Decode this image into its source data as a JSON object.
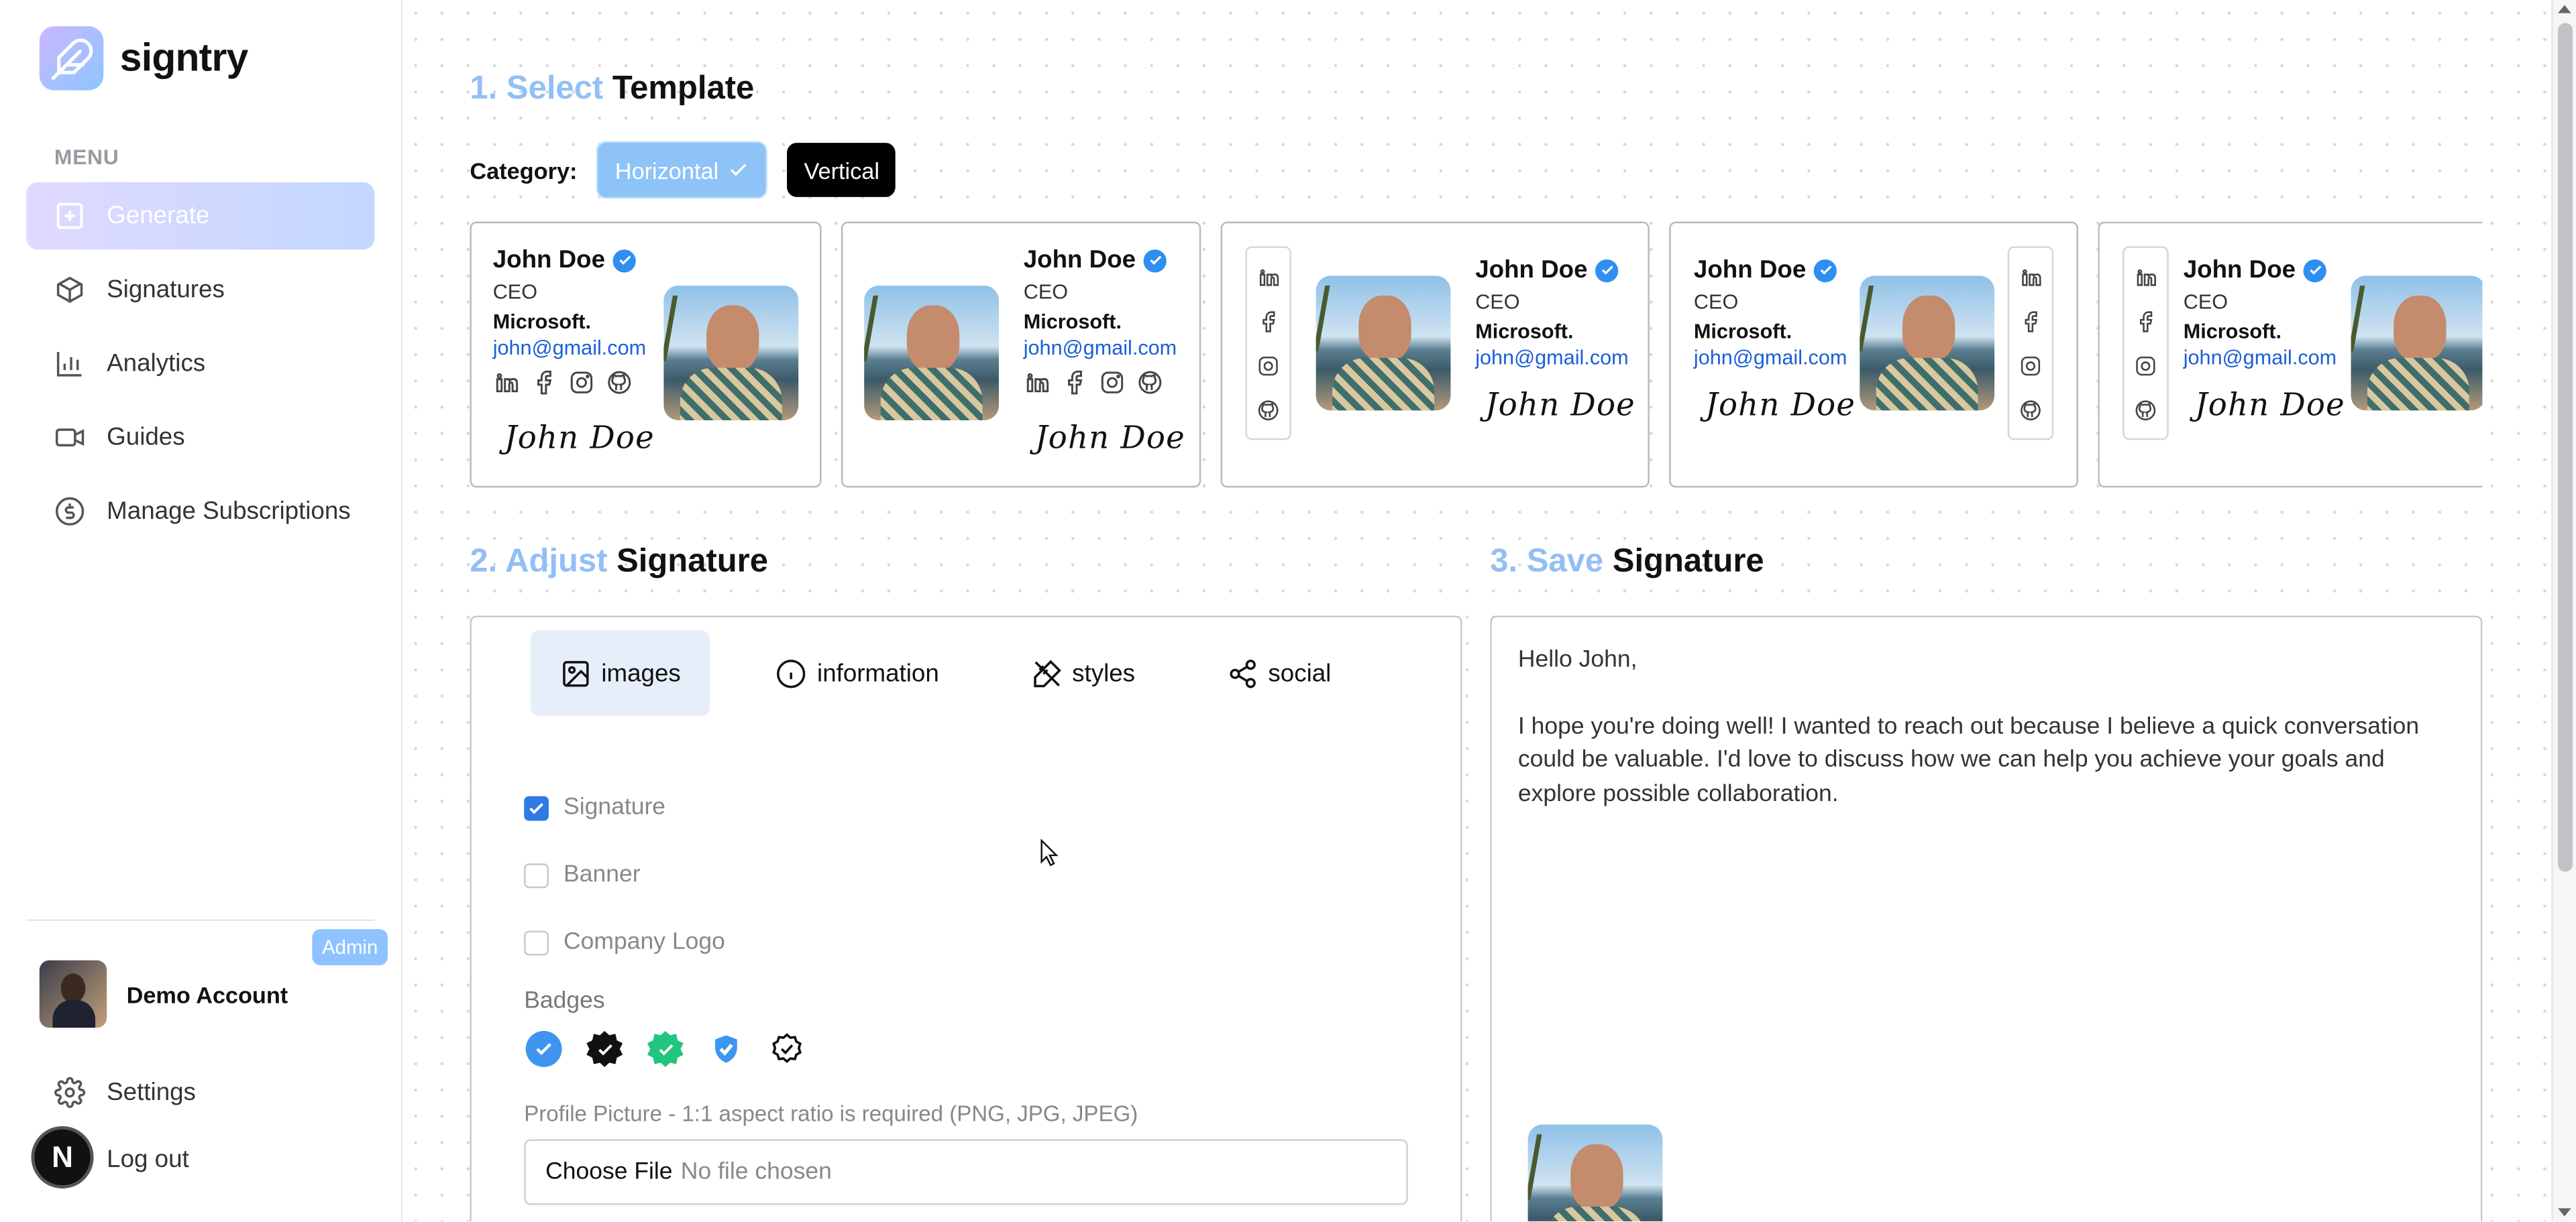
{
  "app": {
    "name": "signtry"
  },
  "sidebar": {
    "menu_label": "MENU",
    "items": [
      {
        "label": "Generate",
        "icon": "plus-square-icon",
        "active": true
      },
      {
        "label": "Signatures",
        "icon": "cube-icon"
      },
      {
        "label": "Analytics",
        "icon": "bar-chart-icon"
      },
      {
        "label": "Guides",
        "icon": "video-icon"
      },
      {
        "label": "Manage Subscriptions",
        "icon": "dollar-circle-icon"
      }
    ],
    "account": {
      "name": "Demo Account",
      "badge": "Admin"
    },
    "settings_label": "Settings",
    "logout_label": "Log out",
    "n_badge": "N"
  },
  "step1": {
    "num": "1.",
    "accent": "Select",
    "rest": "Template",
    "category_label": "Category:",
    "categories": [
      "Horizontal",
      "Vertical"
    ],
    "selected_category": "Horizontal"
  },
  "templates": {
    "name": "John Doe",
    "role": "CEO",
    "company": "Microsoft.",
    "email": "john@gmail.com",
    "signature": "John Doe",
    "socials": [
      "linkedin-icon",
      "facebook-icon",
      "instagram-icon",
      "github-icon"
    ],
    "count": 5
  },
  "step2": {
    "num": "2.",
    "accent": "Adjust",
    "rest": "Signature",
    "tabs": [
      "images",
      "information",
      "styles",
      "social"
    ],
    "active_tab": "images",
    "options": [
      {
        "label": "Signature",
        "checked": true
      },
      {
        "label": "Banner",
        "checked": false
      },
      {
        "label": "Company Logo",
        "checked": false
      }
    ],
    "badges_label": "Badges",
    "badges": [
      "blue-verified-icon",
      "black-verified-icon",
      "green-verified-icon",
      "blue-shield-icon",
      "outline-verified-icon"
    ],
    "profile_label": "Profile Picture - 1:1 aspect ratio is required (PNG, JPG, JPEG)",
    "file_button": "Choose File",
    "file_status": "No file chosen"
  },
  "step3": {
    "num": "3.",
    "accent": "Save",
    "rest": "Signature",
    "greeting": "Hello John,",
    "body": "I hope you're doing well! I wanted to reach out because I believe a quick conversation could be valuable. I'd love to discuss how we can help you achieve your goals and explore possible collaboration."
  },
  "colors": {
    "accent": "#92bff5",
    "link": "#1a5fd6",
    "verify": "#2f8ff0"
  }
}
